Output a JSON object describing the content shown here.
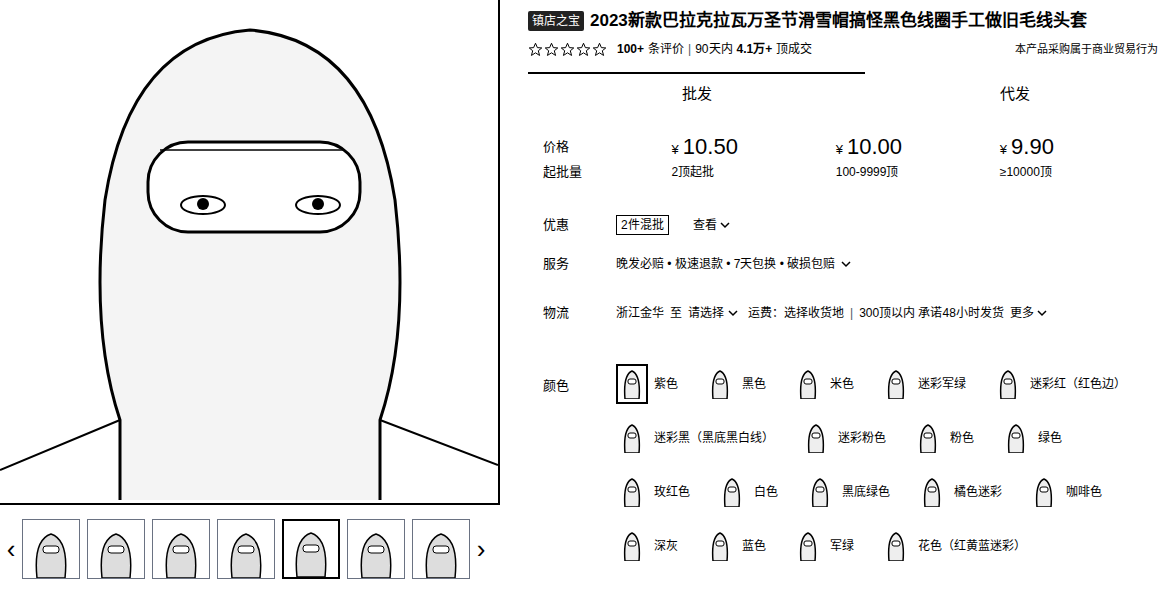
{
  "badge": "镇店之宝",
  "title": "2023新款巴拉克拉瓦万圣节滑雪帽搞怪黑色线圈手工做旧毛线头套",
  "rating": {
    "stars": 0,
    "reviews_count": "100+",
    "reviews_label": "条评价",
    "separator": "|",
    "period": "90天内",
    "sold": "4.1万+",
    "sold_label": "顶成交"
  },
  "notice": "本产品采购属于商业贸易行为",
  "tabs": [
    {
      "label": "批发",
      "selected": true
    },
    {
      "label": "代发",
      "selected": false
    }
  ],
  "price_table": {
    "labels": [
      "价格",
      "起批量"
    ],
    "tiers": [
      {
        "currency": "¥",
        "price": "10.50",
        "quantity": "2顶起批"
      },
      {
        "currency": "¥",
        "price": "10.00",
        "quantity": "100-9999顶"
      },
      {
        "currency": "¥",
        "price": "9.90",
        "quantity": "≥10000顶"
      }
    ]
  },
  "discount": {
    "label": "优惠",
    "tag": "2件混批",
    "link": "查看"
  },
  "service": {
    "label": "服务",
    "text": "晚发必赔 • 极速退款 • 7天包换 • 破损包赔"
  },
  "logistics": {
    "label": "物流",
    "origin": "浙江金华",
    "to": "至",
    "destination": "请选择",
    "fee": "运费：选择收货地",
    "separator": "|",
    "promise": "300顶以内 承诺48小时发货",
    "more": "更多"
  },
  "colors": {
    "label": "颜色",
    "rows": [
      [
        {
          "name": "紫色",
          "selected": true
        },
        {
          "name": "黑色",
          "selected": false
        },
        {
          "name": "米色",
          "selected": false
        },
        {
          "name": "迷彩军绿",
          "selected": false
        },
        {
          "name": "迷彩红（红色边）",
          "selected": false
        }
      ],
      [
        {
          "name": "迷彩黑（黑底黑白线）",
          "selected": false
        },
        {
          "name": "迷彩粉色",
          "selected": false
        },
        {
          "name": "粉色",
          "selected": false
        },
        {
          "name": "绿色",
          "selected": false
        }
      ],
      [
        {
          "name": "玫红色",
          "selected": false
        },
        {
          "name": "白色",
          "selected": false
        },
        {
          "name": "黑底绿色",
          "selected": false
        },
        {
          "name": "橘色迷彩",
          "selected": false
        },
        {
          "name": "咖啡色",
          "selected": false
        }
      ],
      [
        {
          "name": "深灰",
          "selected": false
        },
        {
          "name": "蓝色",
          "selected": false
        },
        {
          "name": "军绿",
          "selected": false
        },
        {
          "name": "花色（红黄蓝迷彩）",
          "selected": false
        }
      ]
    ]
  },
  "gallery": {
    "prev": "‹",
    "next": "›",
    "thumbnails": [
      {
        "selected": false
      },
      {
        "selected": false
      },
      {
        "selected": false
      },
      {
        "selected": false
      },
      {
        "selected": true
      },
      {
        "selected": false
      },
      {
        "selected": false
      }
    ]
  }
}
